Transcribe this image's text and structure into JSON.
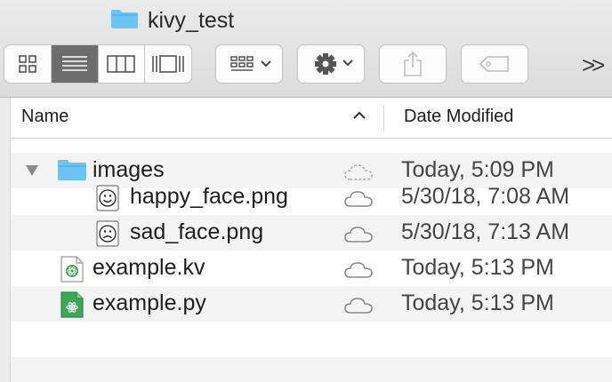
{
  "window": {
    "title": "kivy_test",
    "folder_icon": "folder-icon"
  },
  "toolbar": {
    "view_modes": [
      {
        "name": "icon-view",
        "icon": "grid-icon",
        "active": false
      },
      {
        "name": "list-view",
        "icon": "list-icon",
        "active": true
      },
      {
        "name": "column-view",
        "icon": "columns-icon",
        "active": false
      },
      {
        "name": "gallery-view",
        "icon": "gallery-icon",
        "active": false
      }
    ],
    "group_icon": "group-by-icon",
    "action_icon": "gear-icon",
    "share_icon": "share-icon",
    "tag_icon": "tag-icon",
    "overflow_label": ">>"
  },
  "columns": {
    "name": "Name",
    "date_modified": "Date Modified",
    "sort": "ascending"
  },
  "files": [
    {
      "name": "images",
      "date": "Today, 5:09 PM",
      "type": "folder",
      "icon": "folder-icon",
      "expanded": true,
      "cloud": "uploading"
    },
    {
      "name": "happy_face.png",
      "date": "5/30/18, 7:08 AM",
      "type": "png",
      "icon": "happy-face-icon",
      "cloud": "synced"
    },
    {
      "name": "sad_face.png",
      "date": "5/30/18, 7:13 AM",
      "type": "png",
      "icon": "sad-face-icon",
      "cloud": "synced"
    },
    {
      "name": "example.kv",
      "date": "Today, 5:13 PM",
      "type": "kv",
      "icon": "kivy-file-icon",
      "cloud": "synced"
    },
    {
      "name": "example.py",
      "date": "Today, 5:13 PM",
      "type": "py",
      "icon": "python-file-icon",
      "cloud": "synced"
    }
  ],
  "colors": {
    "folder": "#6cc4f5",
    "selected_view": "#6d6d6d",
    "alt_row": "#f4f4f4"
  }
}
